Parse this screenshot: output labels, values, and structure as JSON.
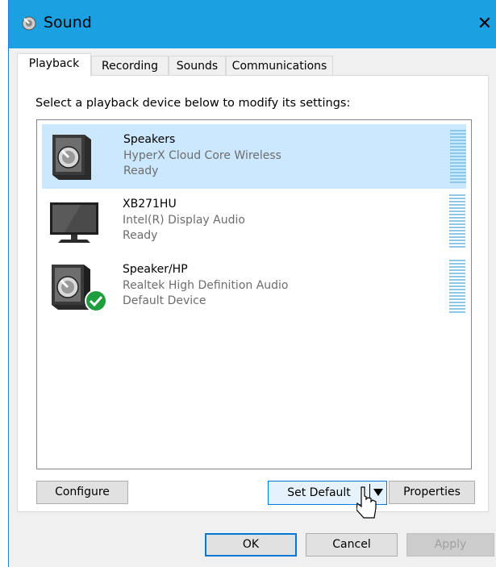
{
  "window": {
    "title": "Sound",
    "close_glyph": "✕"
  },
  "tabs": [
    {
      "label": "Playback",
      "active": true
    },
    {
      "label": "Recording",
      "active": false
    },
    {
      "label": "Sounds",
      "active": false
    },
    {
      "label": "Communications",
      "active": false
    }
  ],
  "playback": {
    "instruction": "Select a playback device below to modify its settings:",
    "devices": [
      {
        "name": "Speakers",
        "description": "HyperX Cloud Core Wireless",
        "status": "Ready",
        "icon": "speaker-icon",
        "selected": true
      },
      {
        "name": "XB271HU",
        "description": "Intel(R) Display Audio",
        "status": "Ready",
        "icon": "monitor-icon",
        "selected": false
      },
      {
        "name": "Speaker/HP",
        "description": "Realtek High Definition Audio",
        "status": "Default Device",
        "icon": "speaker-icon",
        "default_badge": "green-check-icon",
        "selected": false
      }
    ],
    "buttons": {
      "configure": "Configure",
      "set_default": "Set Default",
      "properties": "Properties"
    }
  },
  "footer": {
    "ok": "OK",
    "cancel": "Cancel",
    "apply": "Apply"
  },
  "colors": {
    "titlebar": "#1ba1e2",
    "selection": "#cce8ff",
    "meter": "#8cc8e8",
    "default_check": "#1e9e3e",
    "focus": "#0078d7"
  }
}
